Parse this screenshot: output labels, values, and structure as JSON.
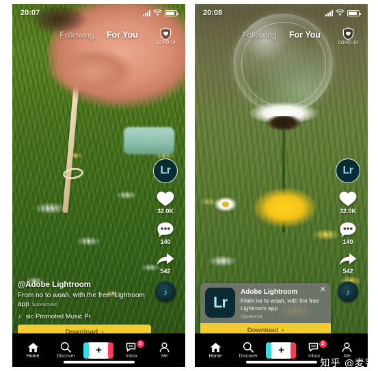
{
  "panels": [
    {
      "id": "left",
      "status": {
        "time": "20:07",
        "signal_icon": "signal-bars-icon",
        "wifi_icon": "wifi-icon",
        "battery_icon": "battery-icon"
      },
      "topnav": {
        "following": "Following",
        "for_you": "For You",
        "active": "For You"
      },
      "covid": {
        "label": "COVID-19",
        "icon": "shield-heart-icon"
      },
      "rail": {
        "avatar_label": "Lr",
        "like_count": "32.0K",
        "comment_count": "140",
        "share_count": "542",
        "like_icon": "heart-icon",
        "comment_icon": "comment-icon",
        "share_icon": "share-arrow-icon",
        "disc_icon": "music-disc-icon"
      },
      "caption": {
        "username": "@Adobe Lightroom",
        "description": "From no to woah, with the free \"Lightroom app",
        "sponsored": "Sponsored",
        "music_note_icon": "music-note-icon",
        "music_marquee": "sic   Promoted Music   Pr"
      },
      "cta": {
        "label": "Download",
        "chevron": "›"
      }
    },
    {
      "id": "right",
      "status": {
        "time": "20:08",
        "signal_icon": "signal-bars-icon",
        "wifi_icon": "wifi-icon",
        "battery_icon": "battery-icon"
      },
      "topnav": {
        "following": "Following",
        "for_you": "For You",
        "active": "For You"
      },
      "covid": {
        "label": "COVID-19",
        "icon": "shield-heart-icon"
      },
      "rail": {
        "avatar_label": "Lr",
        "like_count": "32.0K",
        "comment_count": "140",
        "share_count": "542",
        "like_icon": "heart-icon",
        "comment_icon": "comment-icon",
        "share_icon": "share-arrow-icon",
        "disc_icon": "music-disc-icon"
      },
      "ad_card": {
        "app_icon_label": "Lr",
        "title": "Adobe Lightroom",
        "description": "From no to woah, with the free Lightroom app",
        "sponsored": "Sponsored",
        "close_icon": "close-icon",
        "cta_label": "Download",
        "cta_chevron": "›"
      }
    }
  ],
  "tabbar": {
    "items": [
      {
        "label": "Home",
        "icon": "home-icon",
        "badge": ""
      },
      {
        "label": "Discover",
        "icon": "search-icon",
        "badge": ""
      },
      {
        "label": "",
        "icon": "plus-create-icon",
        "badge": ""
      },
      {
        "label": "Inbox",
        "icon": "inbox-message-icon",
        "badge": "2"
      },
      {
        "label": "Me",
        "icon": "person-icon",
        "badge": ""
      }
    ]
  },
  "watermark": {
    "text": "知乎 @麦客"
  },
  "colors": {
    "cta_yellow": "#f2cb2e",
    "badge_red": "#fe2c55",
    "accent_cyan": "#2ce0e8",
    "lightroom_dark": "#0b2b33",
    "lightroom_blue": "#a6e8f7"
  }
}
